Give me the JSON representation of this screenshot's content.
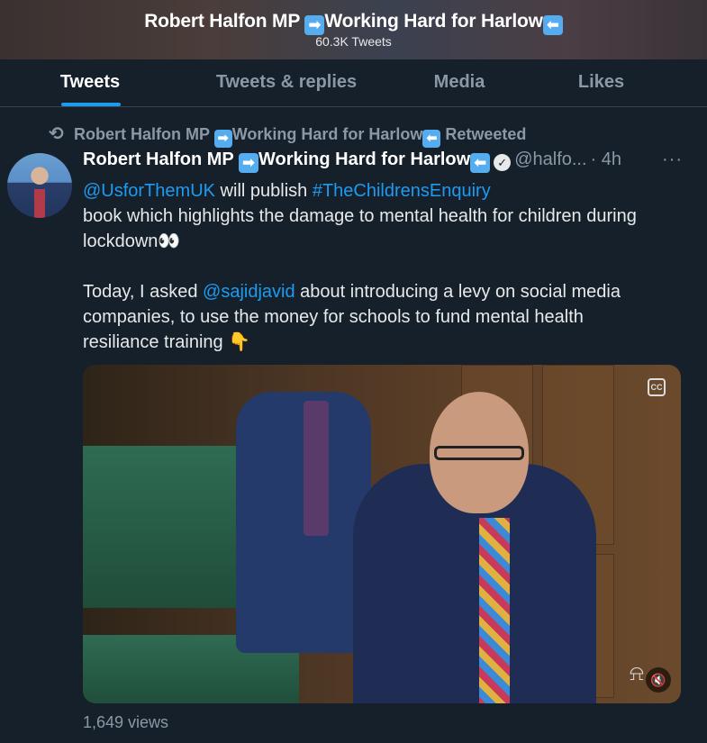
{
  "header": {
    "name_part1": "Robert Halfon MP",
    "emoji_right": "➡",
    "name_part2": "Working Hard for Harlow",
    "emoji_left": "⬅",
    "tweet_count": "60.3K Tweets"
  },
  "tabs": [
    {
      "label": "Tweets",
      "active": true
    },
    {
      "label": "Tweets & replies",
      "active": false
    },
    {
      "label": "Media",
      "active": false
    },
    {
      "label": "Likes",
      "active": false
    }
  ],
  "retweet": {
    "icon": "retweet-icon",
    "name_part1": "Robert Halfon MP",
    "emoji_right": "➡",
    "name_part2": "Working Hard for Harlow",
    "emoji_left": "⬅",
    "suffix": "Retweeted"
  },
  "tweet": {
    "author_part1": "Robert Halfon MP",
    "emoji_right": "➡",
    "author_part2": "Working Hard for Harlow",
    "emoji_left": "⬅",
    "verified_glyph": "✓",
    "handle": "@halfo...",
    "time": "· 4h",
    "more": "···",
    "line1_mention": "@UsforThemUK",
    "line1_text": " will publish ",
    "line1_hashtag": "#TheChildrensEnquiry",
    "line2": "book which highlights the damage to mental health for children during",
    "line3": "lockdown👀",
    "line4_start": "Today, I asked ",
    "line4_mention": "@sajidjavid",
    "line4_end": " about introducing a levy on social media",
    "line5": "companies, to use the money for schools to fund mental health",
    "line6": "resiliance training 👇",
    "views": "1,649 views"
  },
  "media": {
    "cc_label": "CC",
    "mute_glyph": "🔇",
    "portcullis_glyph": "⍾"
  },
  "colors": {
    "background": "#15202b",
    "accent": "#1d9bf0",
    "muted": "#8b98a5"
  }
}
